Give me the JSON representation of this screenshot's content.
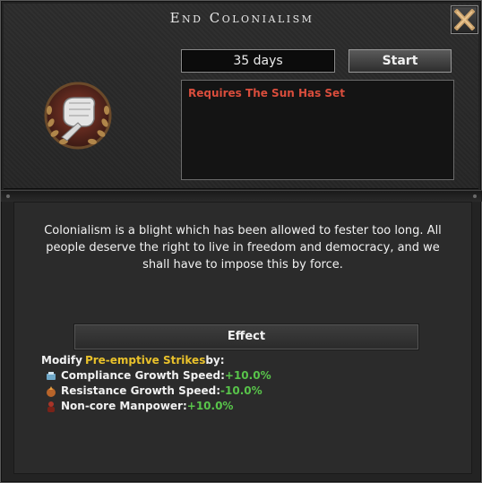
{
  "window": {
    "title": "End Colonialism"
  },
  "timer": {
    "duration": "35 days",
    "start_label": "Start"
  },
  "requirements": {
    "text": "Requires The Sun Has Set"
  },
  "description": "Colonialism is a blight which has been allowed to fester too long. All people deserve the right to live in freedom and democracy, and we shall have to impose this by force.",
  "effect": {
    "header": "Effect",
    "modify_prefix": "Modify ",
    "modify_target": "Pre-emptive Strikes",
    "modify_suffix": " by:",
    "lines": [
      {
        "icon": "compliance-icon",
        "label": "Compliance Growth Speed: ",
        "value": "+10.0%"
      },
      {
        "icon": "resistance-icon",
        "label": "Resistance Growth Speed: ",
        "value": "-10.0%"
      },
      {
        "icon": "manpower-icon",
        "label": "Non-core Manpower: ",
        "value": "+10.0%"
      }
    ]
  },
  "colors": {
    "requirement": "#d94d3c",
    "highlight": "#e9c12b",
    "positive": "#58c44a"
  },
  "icons": {
    "close": "close-icon",
    "emblem": "fist-emblem-icon"
  }
}
